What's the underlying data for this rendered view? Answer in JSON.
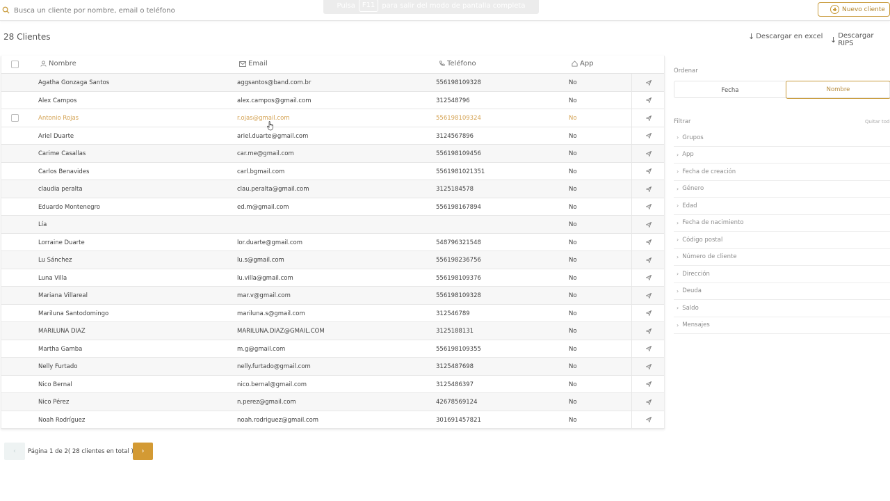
{
  "search": {
    "placeholder": "Busca un cliente por nombre, email o teléfono"
  },
  "toast": {
    "prefix": "Pulsa",
    "key": "F11",
    "suffix": "para salir del modo de pantalla completa"
  },
  "header": {
    "new_client_label": "Nuevo cliente",
    "count_label": "28 Clientes",
    "download_excel_label": "Descargar en excel",
    "download_rips_label": "Descargar RIPS"
  },
  "table": {
    "columns": {
      "name": "Nombre",
      "email": "Email",
      "phone": "Teléfono",
      "app": "App"
    },
    "rows": [
      {
        "name": "Agatha Gonzaga Santos",
        "email": "aggsantos@band.com.br",
        "phone": "556198109328",
        "app": "No"
      },
      {
        "name": "Alex Campos",
        "email": "alex.campos@gmail.com",
        "phone": "312548796",
        "app": "No"
      },
      {
        "name": "Antonio Rojas",
        "email": "r.ojas@gmail.com",
        "phone": "556198109324",
        "app": "No"
      },
      {
        "name": "Ariel Duarte",
        "email": "ariel.duarte@gmail.com",
        "phone": "3124567896",
        "app": "No"
      },
      {
        "name": "Carime Casallas",
        "email": "car.me@gmail.com",
        "phone": "556198109456",
        "app": "No"
      },
      {
        "name": "Carlos Benavides",
        "email": "carl.bgmail.com",
        "phone": "5561981021351",
        "app": "No"
      },
      {
        "name": "claudia peralta",
        "email": "clau.peralta@gmail.com",
        "phone": "3125184578",
        "app": "No"
      },
      {
        "name": "Eduardo Montenegro",
        "email": "ed.m@gmail.com",
        "phone": "556198167894",
        "app": "No"
      },
      {
        "name": "Lía",
        "email": "",
        "phone": "",
        "app": "No"
      },
      {
        "name": "Lorraine Duarte",
        "email": "lor.duarte@gmail.com",
        "phone": "548796321548",
        "app": "No"
      },
      {
        "name": "Lu Sánchez",
        "email": "lu.s@gmail.com",
        "phone": "556198236756",
        "app": "No"
      },
      {
        "name": "Luna Villa",
        "email": "lu.villa@gmail.com",
        "phone": "556198109376",
        "app": "No"
      },
      {
        "name": "Mariana Villareal",
        "email": "mar.v@gmail.com",
        "phone": "556198109328",
        "app": "No"
      },
      {
        "name": "Mariluna Santodomingo",
        "email": "mariluna.s@gmail.com",
        "phone": "312546789",
        "app": "No"
      },
      {
        "name": "MARILUNA DIAZ",
        "email": "MARILUNA.DIAZ@GMAIL.COM",
        "phone": "3125188131",
        "app": "No"
      },
      {
        "name": "Martha Gamba",
        "email": "m.g@gmail.com",
        "phone": "556198109355",
        "app": "No"
      },
      {
        "name": "Nelly Furtado",
        "email": "nelly.furtado@gmail.com",
        "phone": "3125487698",
        "app": "No"
      },
      {
        "name": "Nico Bernal",
        "email": "nico.bernal@gmail.com",
        "phone": "3125486397",
        "app": "No"
      },
      {
        "name": "Nico Pérez",
        "email": "n.perez@gmail.com",
        "phone": "42678569124",
        "app": "No"
      },
      {
        "name": "Noah Rodríguez",
        "email": "noah.rodriguez@gmail.com",
        "phone": "301691457821",
        "app": "No"
      }
    ],
    "hovered_row": 2
  },
  "pagination": {
    "prev": "‹",
    "text": "Página 1 de 2( 28 clientes en total )",
    "next": "›"
  },
  "panel": {
    "order_label": "Ordenar",
    "order_options": [
      "Fecha",
      "Nombre"
    ],
    "order_selected": "Nombre",
    "filter_label": "Filtrar",
    "clear_label": "Quitar todo",
    "filters": [
      "Grupos",
      "App",
      "Fecha de creación",
      "Género",
      "Edad",
      "Fecha de nacimiento",
      "Código postal",
      "Número de cliente",
      "Dirección",
      "Deuda",
      "Saldo",
      "Mensajes"
    ]
  },
  "colors": {
    "accent": "#c89a3a",
    "accent_fill": "#d39a34",
    "hover_text": "#d4a252"
  }
}
